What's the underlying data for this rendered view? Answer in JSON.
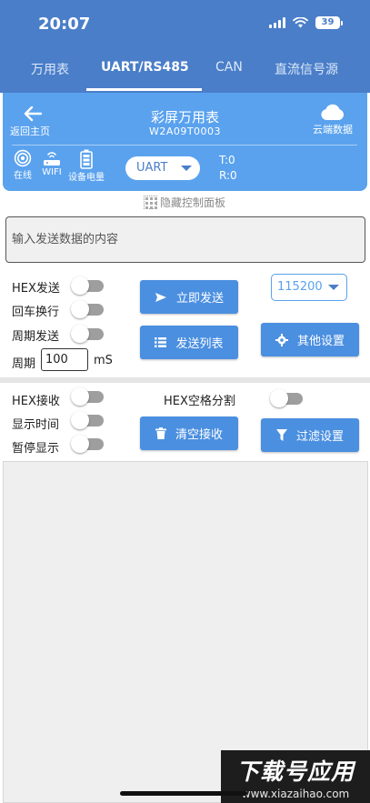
{
  "status_bar": {
    "time": "20:07",
    "battery": "39"
  },
  "tabs": [
    {
      "label": "万用表"
    },
    {
      "label": "UART/RS485",
      "active": true
    },
    {
      "label": "CAN"
    },
    {
      "label": "直流信号源"
    }
  ],
  "header": {
    "back_label": "返回主页",
    "title": "彩屏万用表",
    "device_id": "W2A09T0003",
    "cloud_label": "云端数据",
    "status": {
      "online": "在线",
      "wifi": "WIFI",
      "battery": "设备电量"
    },
    "mode": "UART",
    "tx": "T:0",
    "rx": "R:0"
  },
  "hide_panel_label": "隐藏控制面板",
  "send_input": {
    "placeholder": "输入发送数据的内容",
    "value": ""
  },
  "send_options": {
    "hex_send": "HEX发送",
    "crlf": "回车换行",
    "periodic_send": "周期发送",
    "period_label": "周期",
    "period_value": "100",
    "period_unit": "mS"
  },
  "buttons": {
    "send_now": "立即发送",
    "send_list": "发送列表",
    "other_settings": "其他设置",
    "clear_receive": "清空接收",
    "filter_settings": "过滤设置"
  },
  "baud_rate": "115200",
  "receive_options": {
    "hex_receive": "HEX接收",
    "hex_space": "HEX空格分割",
    "show_time": "显示时间",
    "pause_display": "暂停显示"
  },
  "receive_data": "",
  "watermark": {
    "main": "下载号应用",
    "sub": "www.xiazaihao.com"
  },
  "colors": {
    "primary": "#4a7ec9",
    "header": "#5aa2ee",
    "button": "#4b8fe0",
    "toggle_off": "#9e9e9e"
  }
}
